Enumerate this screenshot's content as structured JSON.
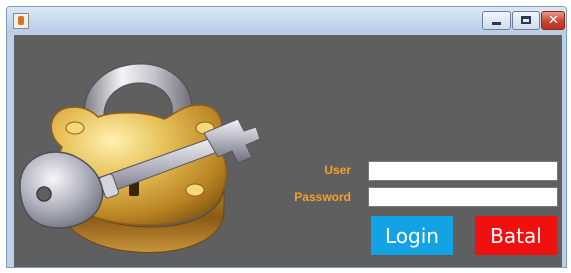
{
  "window": {
    "controls": [
      "minimize-icon",
      "maximize-icon",
      "close-icon"
    ],
    "close_glyph": "✕"
  },
  "form": {
    "user_label": "User",
    "password_label": "Password",
    "user_value": "",
    "password_value": ""
  },
  "buttons": {
    "login_label": "Login",
    "batal_label": "Batal"
  },
  "colors": {
    "background": "#5f5f5f",
    "label": "#f2a12a",
    "login": "#13a2e3",
    "batal": "#f01010"
  },
  "art": {
    "icon": "padlock-with-key-icon"
  }
}
